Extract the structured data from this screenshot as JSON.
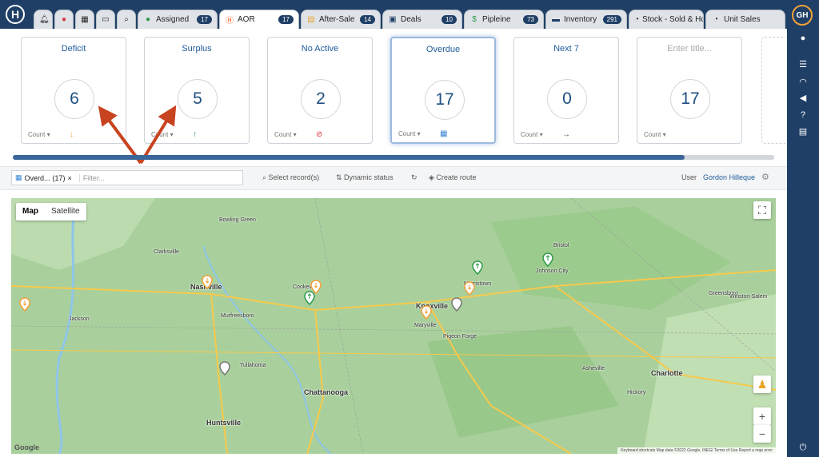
{
  "tabs": [
    {
      "label": "",
      "icon": "bell-icon",
      "badge": ""
    },
    {
      "label": "",
      "icon": "location-pin-icon",
      "badge": ""
    },
    {
      "label": "",
      "icon": "calendar-icon",
      "badge": ""
    },
    {
      "label": "",
      "icon": "chat-icon",
      "badge": ""
    },
    {
      "label": "",
      "icon": "search-icon",
      "badge": ""
    },
    {
      "label": "Assigned",
      "icon": "money-bag-icon",
      "badge": "17"
    },
    {
      "label": "AOR",
      "icon": "h-logo-icon",
      "badge": "17"
    },
    {
      "label": "After-Sale",
      "icon": "document-icon",
      "badge": "14"
    },
    {
      "label": "Deals",
      "icon": "grid-icon",
      "badge": "10"
    },
    {
      "label": "Pipleine",
      "icon": "dollar-icon",
      "badge": "73"
    },
    {
      "label": "Inventory",
      "icon": "folder-icon",
      "badge": "291"
    },
    {
      "label": "Stock - Sold & Hc",
      "icon": "gauge-icon",
      "badge": ""
    },
    {
      "label": "Unit Sales",
      "icon": "gauge-icon",
      "badge": ""
    }
  ],
  "user_initials": "GH",
  "cards": [
    {
      "title": "Deficit",
      "value": "6",
      "footer": "Count ▾",
      "icon": "↓",
      "icon_color": "#f2a13a"
    },
    {
      "title": "Surplus",
      "value": "5",
      "footer": "Count ▾",
      "icon": "↑",
      "icon_color": "#2e9a4a"
    },
    {
      "title": "No Active",
      "value": "2",
      "footer": "Count ▾",
      "icon": "⊘",
      "icon_color": "#d9363e"
    },
    {
      "title": "Overdue",
      "value": "17",
      "footer": "Count ▾",
      "icon": "▦",
      "icon_color": "#3a86d4"
    },
    {
      "title": "Next 7",
      "value": "0",
      "footer": "Count ▾",
      "icon": "→",
      "icon_color": "#555555"
    },
    {
      "title": "Enter title...",
      "value": "17",
      "footer": "Count ▾",
      "icon": "",
      "icon_color": "#555555"
    }
  ],
  "filter": {
    "chip_label": "Overd...",
    "chip_count": "(17)",
    "chip_close": "×",
    "placeholder": "Filter...",
    "select_records": "Select record(s)",
    "dynamic_status": "Dynamic status",
    "create_route": "Create route",
    "user_label": "User",
    "user_name": "Gordon Hilleque"
  },
  "map": {
    "type_map": "Map",
    "type_satellite": "Satellite",
    "google": "Google",
    "attribution": "Keyboard shortcuts   Map data ©2022 Google, INEGI   Terms of Use   Report a map error",
    "cities": [
      {
        "name": "Nashville",
        "big": true
      },
      {
        "name": "Knoxville",
        "big": true
      },
      {
        "name": "Chattanooga",
        "big": true
      },
      {
        "name": "Charlotte",
        "big": true
      },
      {
        "name": "Huntsville",
        "big": true
      },
      {
        "name": "Greensboro",
        "big": false
      },
      {
        "name": "Murfreesboro",
        "big": false
      },
      {
        "name": "Jackson",
        "big": false
      },
      {
        "name": "Bowling Green",
        "big": false
      },
      {
        "name": "Johnson City",
        "big": false
      },
      {
        "name": "Asheville",
        "big": false
      },
      {
        "name": "Morristown",
        "big": false
      },
      {
        "name": "Cookeville",
        "big": false
      },
      {
        "name": "Clarksville",
        "big": false
      },
      {
        "name": "Maryville",
        "big": false
      },
      {
        "name": "Tullahoma",
        "big": false
      },
      {
        "name": "Winston-Salem",
        "big": false
      },
      {
        "name": "Hickory",
        "big": false
      },
      {
        "name": "Bristol",
        "big": false
      },
      {
        "name": "Pigeon Forge",
        "big": false
      }
    ]
  }
}
